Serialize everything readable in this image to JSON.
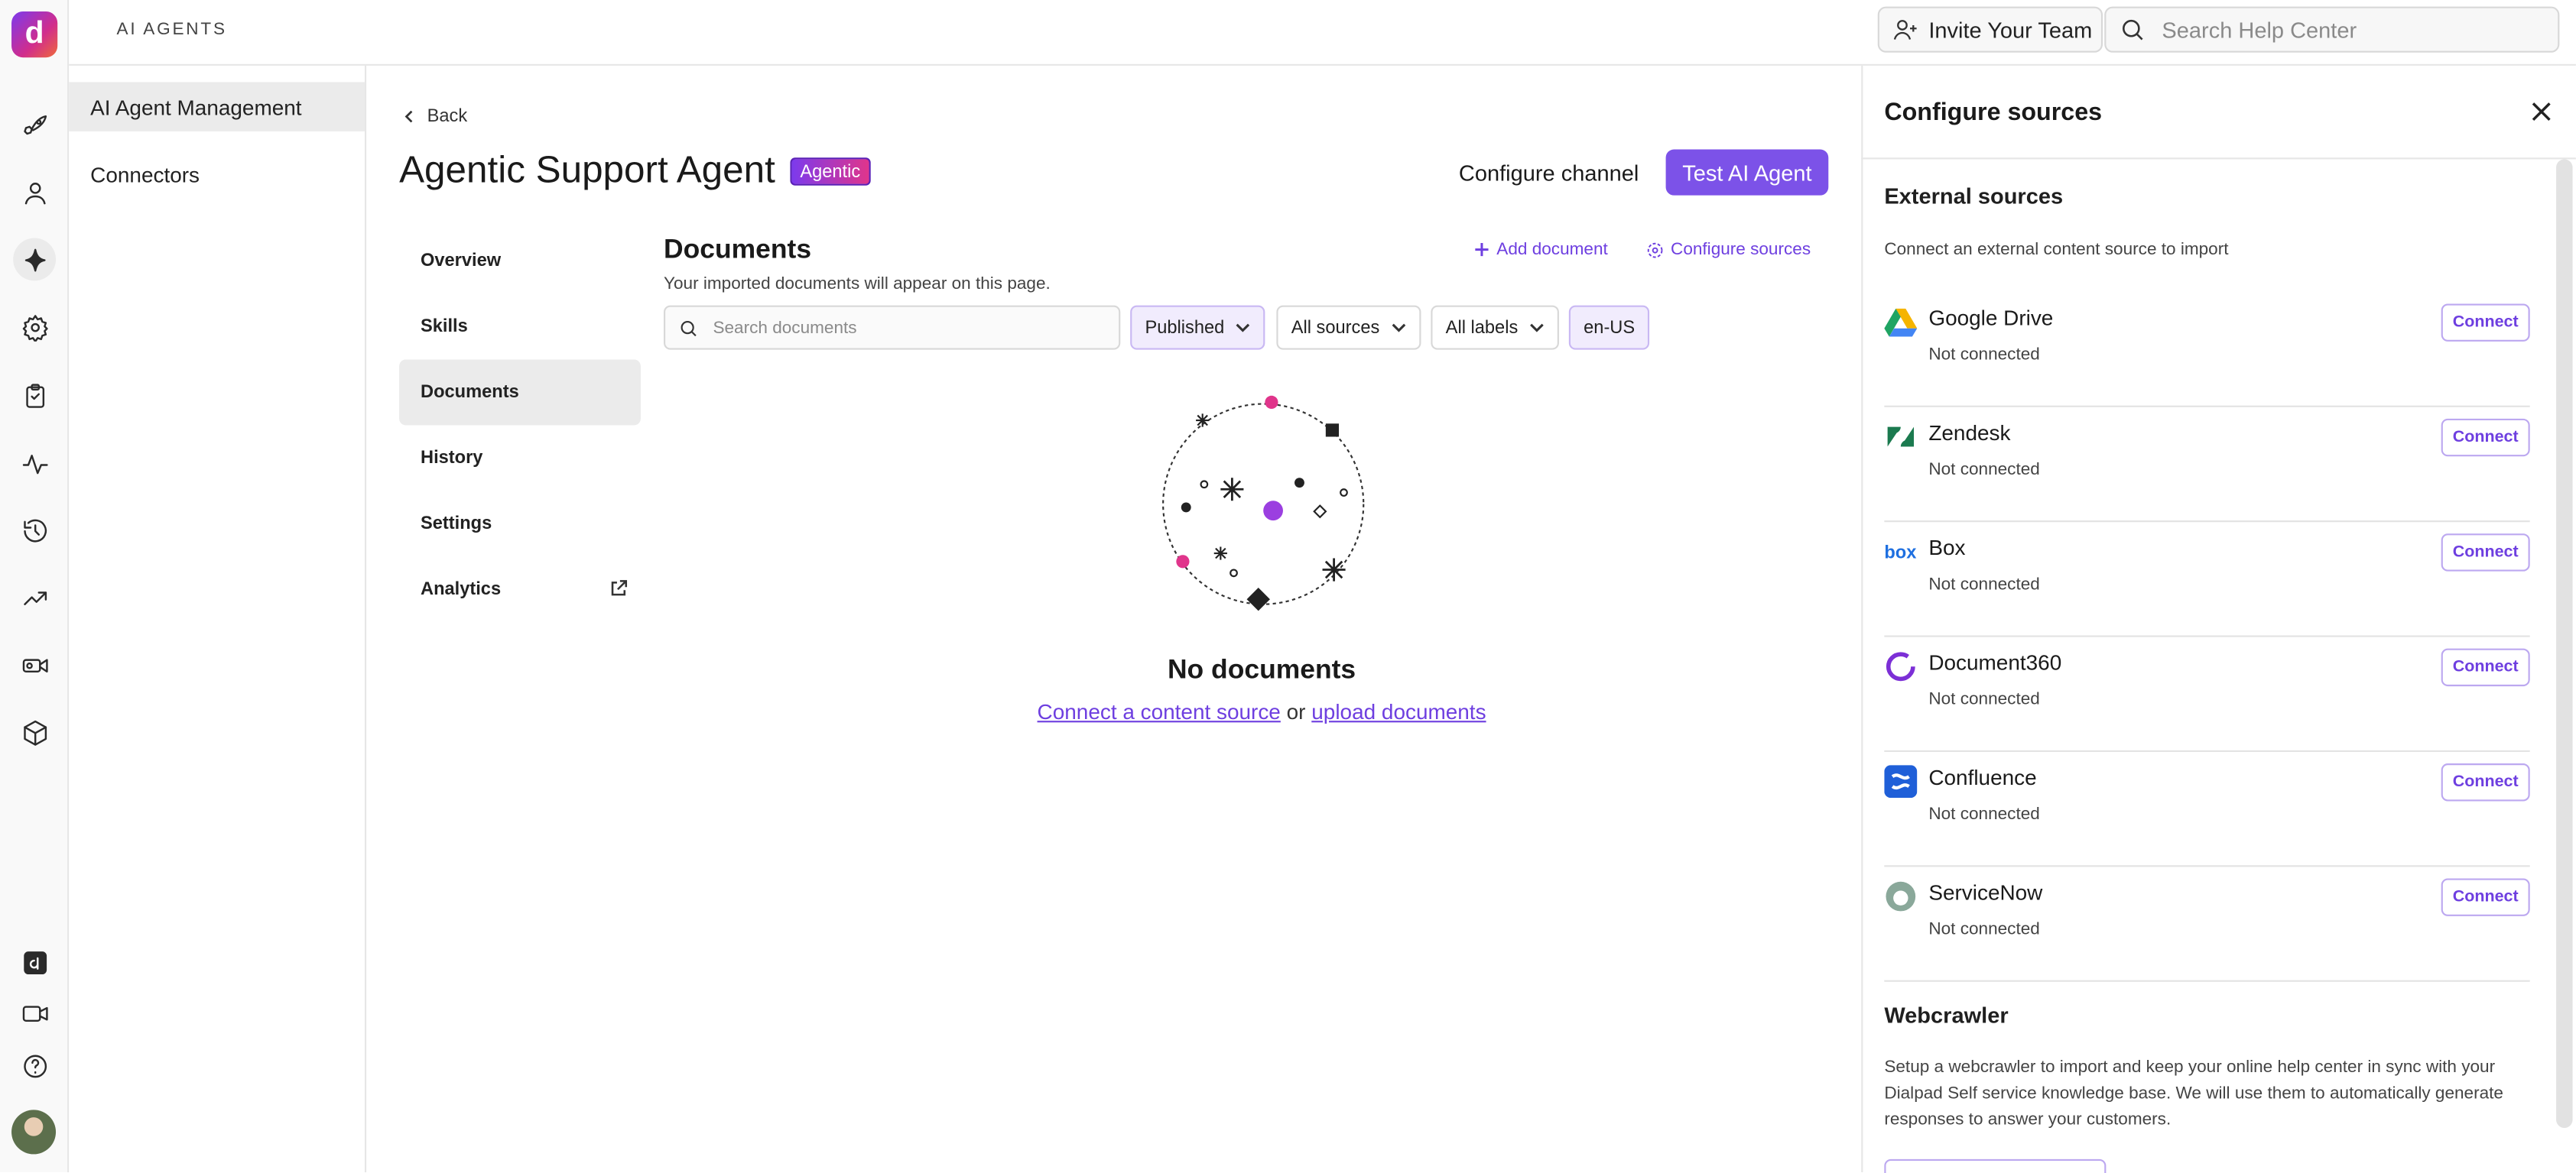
{
  "app": {
    "section_label": "AI AGENTS",
    "logo_letter": "d"
  },
  "topbar": {
    "invite_label": "Invite Your Team",
    "search_placeholder": "Search Help Center"
  },
  "sidebar2": {
    "items": [
      {
        "label": "AI Agent Management",
        "active": true
      },
      {
        "label": "Connectors",
        "active": false
      }
    ]
  },
  "rail": {
    "icons": [
      "rocket-icon",
      "person-icon",
      "sparkle-icon",
      "gear-icon",
      "clipboard-icon",
      "activity-icon",
      "history-icon",
      "trending-icon",
      "video-call-icon",
      "cube-icon",
      "dialpad-app-icon",
      "video-icon",
      "help-icon",
      "avatar"
    ]
  },
  "page": {
    "back_label": "Back",
    "title": "Agentic Support Agent",
    "badge": "Agentic",
    "configure_channel": "Configure channel",
    "test_agent": "Test AI Agent",
    "subnav": [
      {
        "label": "Overview",
        "active": false
      },
      {
        "label": "Skills",
        "active": false
      },
      {
        "label": "Documents",
        "active": true
      },
      {
        "label": "History",
        "active": false
      },
      {
        "label": "Settings",
        "active": false
      },
      {
        "label": "Analytics",
        "active": false
      }
    ]
  },
  "documents": {
    "title": "Documents",
    "subtitle": "Your imported documents will appear on this page.",
    "add_document": "Add document",
    "configure_sources": "Configure sources",
    "search_placeholder": "Search documents",
    "filters": {
      "status": "Published",
      "sources": "All sources",
      "labels": "All labels",
      "locale": "en-US"
    },
    "empty": {
      "title": "No documents",
      "connect_link": "Connect a content source",
      "or": "or",
      "upload_link": "upload documents"
    }
  },
  "panel": {
    "title": "Configure sources",
    "external_title": "External sources",
    "external_sub": "Connect an external content source to import",
    "connect_label": "Connect",
    "sources": [
      {
        "name": "Google Drive",
        "status": "Not connected",
        "icon": "google-drive-icon"
      },
      {
        "name": "Zendesk",
        "status": "Not connected",
        "icon": "zendesk-icon"
      },
      {
        "name": "Box",
        "status": "Not connected",
        "icon": "box-icon"
      },
      {
        "name": "Document360",
        "status": "Not connected",
        "icon": "document360-icon"
      },
      {
        "name": "Confluence",
        "status": "Not connected",
        "icon": "confluence-icon"
      },
      {
        "name": "ServiceNow",
        "status": "Not connected",
        "icon": "servicenow-icon"
      }
    ],
    "webcrawler_title": "Webcrawler",
    "webcrawler_text": "Setup a webcrawler to import and keep your online help center in sync with your Dialpad Self service knowledge base. We will use them to automatically generate responses to answer your customers."
  },
  "colors": {
    "accent": "#7c52e8",
    "link": "#6e3fe0"
  }
}
